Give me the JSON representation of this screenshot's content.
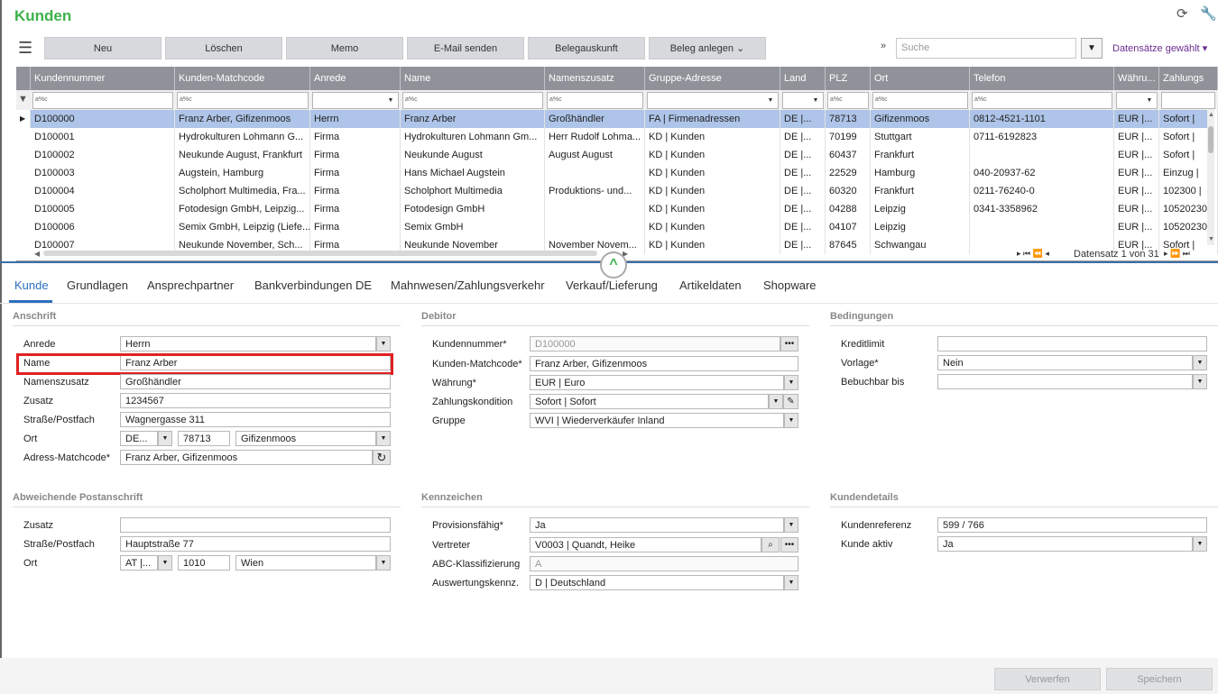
{
  "header": {
    "title": "Kunden"
  },
  "toolbar": {
    "buttons": [
      "Neu",
      "Löschen",
      "Memo",
      "E-Mail senden",
      "Belegauskunft",
      "Beleg anlegen"
    ],
    "search_placeholder": "Suche",
    "selection_label": "Datensätze gewählt"
  },
  "grid": {
    "columns": [
      "Kundennummer",
      "Kunden-Matchcode",
      "Anrede",
      "Name",
      "Namenszusatz",
      "Gruppe-Adresse",
      "Land",
      "PLZ",
      "Ort",
      "Telefon",
      "Währu...",
      "Zahlungs"
    ],
    "rows": [
      [
        "D100000",
        "Franz Arber, Gifizenmoos",
        "Herrn",
        "Franz Arber",
        "Großhändler",
        "FA  |  Firmenadressen",
        "DE  |...",
        "78713",
        "Gifizenmoos",
        "0812-4521-1101",
        "EUR  |...",
        "Sofort  |"
      ],
      [
        "D100001",
        "Hydrokulturen Lohmann G...",
        "Firma",
        "Hydrokulturen Lohmann Gm...",
        "Herr Rudolf Lohma...",
        "KD  |  Kunden",
        "DE  |...",
        "70199",
        "Stuttgart",
        "0711-6192823",
        "EUR  |...",
        "Sofort  |"
      ],
      [
        "D100002",
        "Neukunde August, Frankfurt",
        "Firma",
        "Neukunde August",
        "August August",
        "KD  |  Kunden",
        "DE  |...",
        "60437",
        "Frankfurt",
        "",
        "EUR  |...",
        "Sofort  |"
      ],
      [
        "D100003",
        "Augstein, Hamburg",
        "Firma",
        "Hans Michael Augstein",
        "",
        "KD  |  Kunden",
        "DE  |...",
        "22529",
        "Hamburg",
        "040-20937-62",
        "EUR  |...",
        "Einzug  |"
      ],
      [
        "D100004",
        "Scholphort Multimedia, Fra...",
        "Firma",
        "Scholphort Multimedia",
        "Produktions- und...",
        "KD  |  Kunden",
        "DE  |...",
        "60320",
        "Frankfurt",
        "0211-76240-0",
        "EUR  |...",
        "102300  |"
      ],
      [
        "D100005",
        "Fotodesign GmbH, Leipzig...",
        "Firma",
        "Fotodesign GmbH",
        "",
        "KD  |  Kunden",
        "DE  |...",
        "04288",
        "Leipzig",
        "0341-3358962",
        "EUR  |...",
        "10520230"
      ],
      [
        "D100006",
        "Semix GmbH, Leipzig (Liefe...",
        "Firma",
        "Semix GmbH",
        "",
        "KD  |  Kunden",
        "DE  |...",
        "04107",
        "Leipzig",
        "",
        "EUR  |...",
        "10520230"
      ],
      [
        "D100007",
        "Neukunde November, Sch...",
        "Firma",
        "Neukunde November",
        "November Novem...",
        "KD  |  Kunden",
        "DE  |...",
        "87645",
        "Schwangau",
        "",
        "EUR  |...",
        "Sofort  |"
      ]
    ],
    "pager": "Datensatz 1 von 31"
  },
  "tabs": [
    "Kunde",
    "Grundlagen",
    "Ansprechpartner",
    "Bankverbindungen DE",
    "Mahnwesen/Zahlungsverkehr",
    "Verkauf/Lieferung",
    "Artikeldaten",
    "Shopware"
  ],
  "anschrift": {
    "title": "Anschrift",
    "anrede_label": "Anrede",
    "anrede": "Herrn",
    "name_label": "Name",
    "name": "Franz Arber",
    "namenszusatz_label": "Namenszusatz",
    "namenszusatz": "Großhändler",
    "zusatz_label": "Zusatz",
    "zusatz": "1234567",
    "strasse_label": "Straße/Postfach",
    "strasse": "Wagnergasse 311",
    "ort_label": "Ort",
    "land": "DE...",
    "plz": "78713",
    "ort": "Gifizenmoos",
    "matchcode_label": "Adress-Matchcode*",
    "matchcode": "Franz Arber, Gifizenmoos"
  },
  "debitor": {
    "title": "Debitor",
    "kundennummer_label": "Kundennummer*",
    "kundennummer": "D100000",
    "matchcode_label": "Kunden-Matchcode*",
    "matchcode": "Franz Arber, Gifizenmoos",
    "waehrung_label": "Währung*",
    "waehrung": "EUR  |  Euro",
    "zahlung_label": "Zahlungskondition",
    "zahlung": "Sofort  |  Sofort",
    "gruppe_label": "Gruppe",
    "gruppe": "WVI  |  Wiederverkäufer Inland"
  },
  "bedingungen": {
    "title": "Bedingungen",
    "kreditlimit_label": "Kreditlimit",
    "kreditlimit": "",
    "vorlage_label": "Vorlage*",
    "vorlage": "Nein",
    "bebuchbar_label": "Bebuchbar bis",
    "bebuchbar": ""
  },
  "abweichend": {
    "title": "Abweichende Postanschrift",
    "zusatz_label": "Zusatz",
    "zusatz": "",
    "strasse_label": "Straße/Postfach",
    "strasse": "Hauptstraße 77",
    "ort_label": "Ort",
    "land": "AT  |...",
    "plz": "1010",
    "ort": "Wien"
  },
  "kennzeichen": {
    "title": "Kennzeichen",
    "provision_label": "Provisionsfähig*",
    "provision": "Ja",
    "vertreter_label": "Vertreter",
    "vertreter": "V0003  |  Quandt, Heike",
    "abc_label": "ABC-Klassifizierung",
    "abc": "A",
    "auswertung_label": "Auswertungskennz.",
    "auswertung": "D  |  Deutschland"
  },
  "kundendetails": {
    "title": "Kundendetails",
    "referenz_label": "Kundenreferenz",
    "referenz": "599 / 766",
    "aktiv_label": "Kunde aktiv",
    "aktiv": "Ja"
  },
  "footer": {
    "discard": "Verwerfen",
    "save": "Speichern"
  }
}
